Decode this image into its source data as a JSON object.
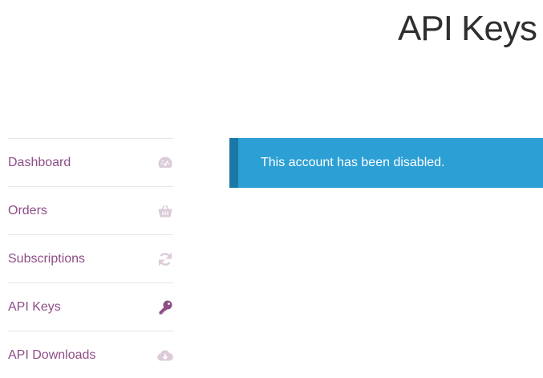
{
  "page": {
    "title": "API Keys"
  },
  "sidebar": {
    "items": [
      {
        "label": "Dashboard",
        "icon": "dashboard-gauge-icon",
        "active": false
      },
      {
        "label": "Orders",
        "icon": "basket-icon",
        "active": false
      },
      {
        "label": "Subscriptions",
        "icon": "refresh-icon",
        "active": false
      },
      {
        "label": "API Keys",
        "icon": "key-icon",
        "active": true
      },
      {
        "label": "API Downloads",
        "icon": "cloud-download-icon",
        "active": false
      }
    ]
  },
  "notice": {
    "message": "This account has been disabled."
  },
  "colors": {
    "link": "#8e4d87",
    "icon_muted": "#dccbd9",
    "notice_bg": "#2c9fd4",
    "notice_border": "#1b78a6",
    "title": "#2f2f2f"
  }
}
